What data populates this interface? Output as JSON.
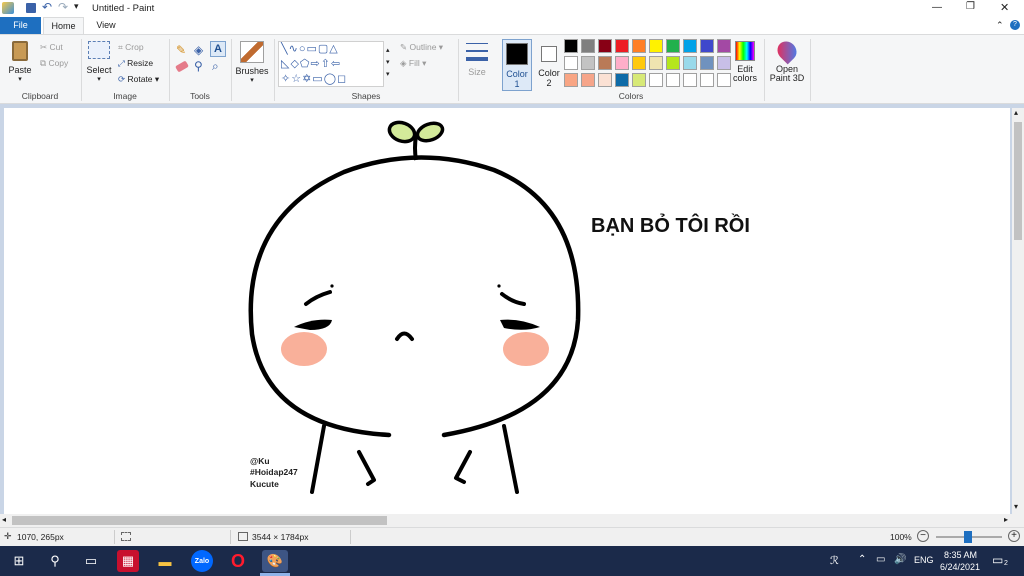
{
  "window": {
    "title": "Untitled - Paint",
    "min_glyph": "—",
    "max_glyph": "❐",
    "close_glyph": "✕"
  },
  "tabs": {
    "file": "File",
    "home": "Home",
    "view": "View"
  },
  "ribbon": {
    "clipboard": {
      "label": "Clipboard",
      "paste": "Paste",
      "cut": "Cut",
      "copy": "Copy"
    },
    "image": {
      "label": "Image",
      "select": "Select",
      "crop": "Crop",
      "resize": "Resize",
      "rotate": "Rotate"
    },
    "tools": {
      "label": "Tools"
    },
    "brushes": {
      "label": "Brushes"
    },
    "shapes": {
      "label": "Shapes",
      "outline": "Outline",
      "fill": "Fill"
    },
    "size": {
      "label": "Size"
    },
    "color1": {
      "label": "Color",
      "num": "1",
      "value": "#000000"
    },
    "color2": {
      "label": "Color",
      "num": "2",
      "value": "#ffffff"
    },
    "colors": {
      "label": "Colors",
      "palette": [
        "#000000",
        "#7f7f7f",
        "#880015",
        "#ed1c24",
        "#ff7f27",
        "#fff200",
        "#22b14c",
        "#00a2e8",
        "#3f48cc",
        "#a349a4",
        "#ffffff",
        "#c3c3c3",
        "#b97a57",
        "#ffaec9",
        "#ffc90e",
        "#efe4b0",
        "#b5e61d",
        "#99d9ea",
        "#7092be",
        "#c8bfe7",
        "#f8a584",
        "#f6a58a",
        "#fbe1d4",
        "#0e6ba8",
        "#d7e977",
        "#ffffff",
        "#ffffff",
        "#ffffff",
        "#ffffff",
        "#ffffff"
      ]
    },
    "edit_colors": "Edit colors",
    "paint3d": "Open Paint 3D"
  },
  "drawing": {
    "caption": "BẠN BỎ TÔI RỒI",
    "credit1": "@Ku",
    "credit2": "#Hoidap247",
    "credit3": "Kucute",
    "blush_color": "#f9b09a",
    "sprout_color": "#d3ea9a"
  },
  "status": {
    "cursor_pos": "1070, 265px",
    "image_size": "3544 × 1784px",
    "zoom": "100%"
  },
  "taskbar": {
    "lang": "ENG",
    "time": "8:35 AM",
    "date": "6/24/2021",
    "notif_count": "2",
    "zalo": "Zalo"
  }
}
